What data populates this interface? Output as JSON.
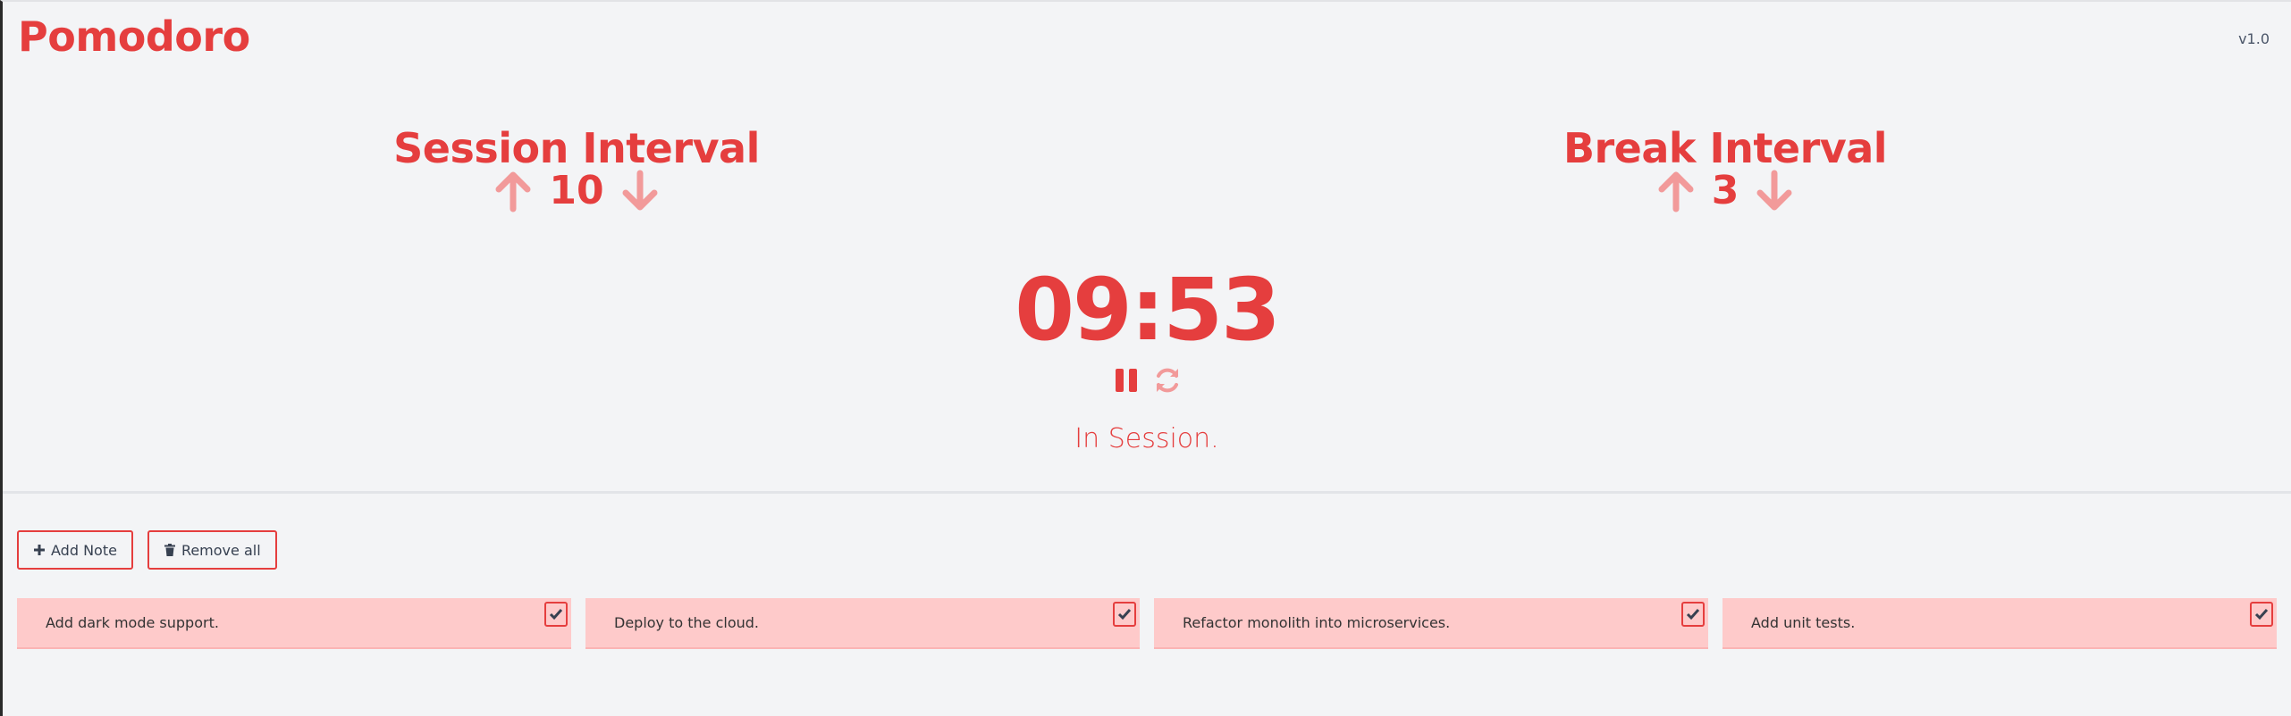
{
  "header": {
    "title": "Pomodoro",
    "version": "v1.0"
  },
  "session": {
    "title": "Session Interval",
    "value": "10"
  },
  "break": {
    "title": "Break Interval",
    "value": "3"
  },
  "timer": {
    "display": "09:53",
    "status": "In Session."
  },
  "toolbar": {
    "add_label": "Add Note",
    "remove_label": "Remove all"
  },
  "notes": [
    {
      "text": "Add dark mode support."
    },
    {
      "text": "Deploy to the cloud."
    },
    {
      "text": "Refactor monolith into microservices."
    },
    {
      "text": "Add unit tests."
    }
  ],
  "icons": {
    "increment": "arrow-up-icon",
    "decrement": "arrow-down-icon",
    "pause": "pause-icon",
    "reset": "refresh-icon",
    "add": "plus-icon",
    "remove": "trash-icon",
    "check": "check-icon"
  },
  "colors": {
    "accent": "#e53e3e",
    "accent_light": "#f29a9a",
    "note_bg": "#fecaca",
    "background": "#f3f4f6"
  }
}
